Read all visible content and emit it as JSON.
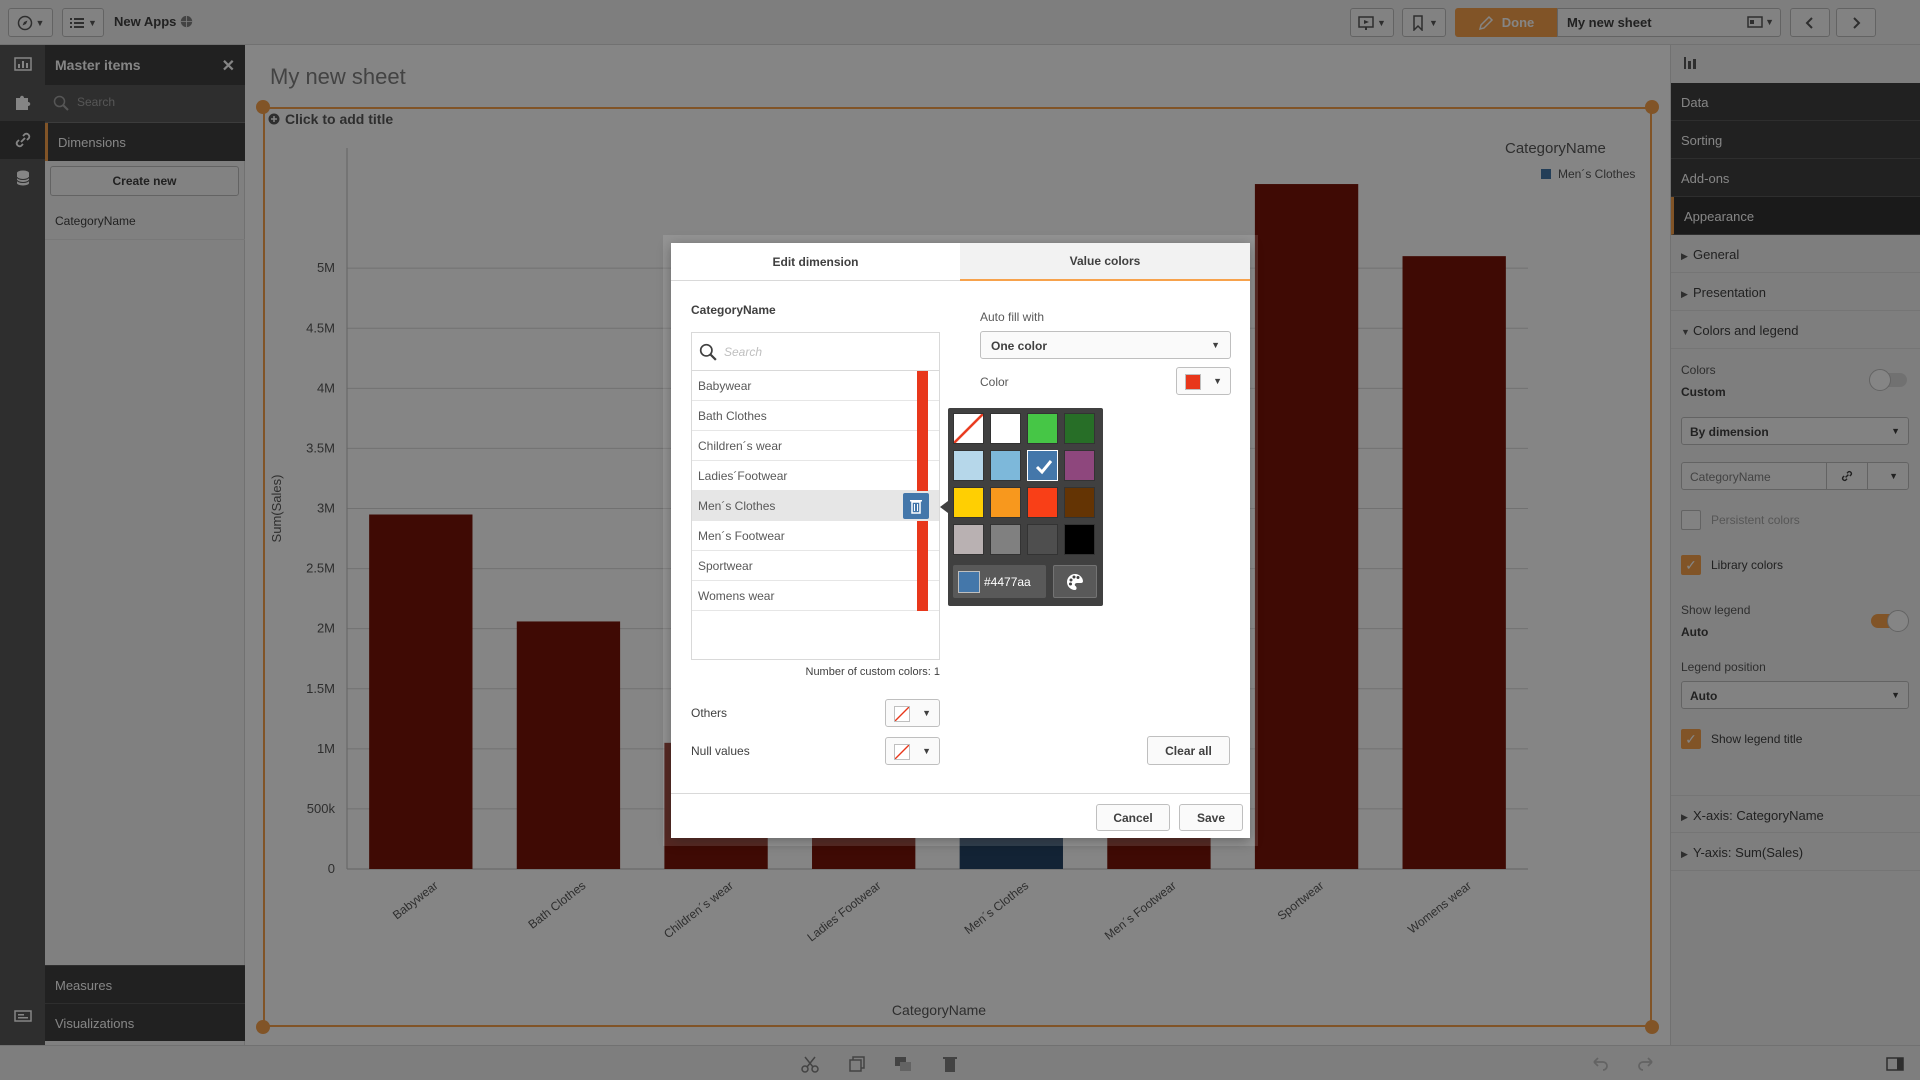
{
  "app": {
    "name": "New Apps"
  },
  "toolbar": {
    "done_label": "Done",
    "sheet_name": "My new sheet"
  },
  "left_panel": {
    "title": "Master items",
    "search_placeholder": "Search",
    "dimensions_label": "Dimensions",
    "create_new_label": "Create new",
    "items": [
      "CategoryName"
    ],
    "measures_label": "Measures",
    "visualizations_label": "Visualizations"
  },
  "sheet": {
    "title": "My new sheet",
    "chart_title_placeholder": "Click to add title"
  },
  "legend": {
    "title": "CategoryName",
    "item": "Men´s Clothes"
  },
  "chart_data": {
    "type": "bar",
    "categories": [
      "Babywear",
      "Bath Clothes",
      "Children´s wear",
      "Ladies´Footwear",
      "Men´s Clothes",
      "Men´s Footwear",
      "Sportwear",
      "Womens wear"
    ],
    "values": [
      2950000,
      2060000,
      1050000,
      800000,
      650000,
      780000,
      5700000,
      5100000
    ],
    "colors": [
      "#7a1408",
      "#7a1408",
      "#7a1408",
      "#7a1408",
      "#264466",
      "#7a1408",
      "#7a1408",
      "#7a1408"
    ],
    "ylabel": "Sum(Sales)",
    "xlabel": "CategoryName",
    "ylim": [
      0,
      6000000
    ],
    "yticks": [
      "0",
      "500k",
      "1M",
      "1.5M",
      "2M",
      "2.5M",
      "3M",
      "3.5M",
      "4M",
      "4.5M",
      "5M"
    ],
    "grid": true
  },
  "right_panel": {
    "tabs": [
      "Data",
      "Sorting",
      "Add-ons",
      "Appearance"
    ],
    "sections": [
      "General",
      "Presentation",
      "Colors and legend"
    ],
    "colors_label": "Colors",
    "colors_value": "Custom",
    "color_mode": "By dimension",
    "dimension_field": "CategoryName",
    "persistent_colors": "Persistent colors",
    "library_colors": "Library colors",
    "show_legend_label": "Show legend",
    "show_legend_value": "Auto",
    "legend_position_label": "Legend position",
    "legend_position_value": "Auto",
    "show_legend_title": "Show legend title",
    "x_axis": "X-axis: CategoryName",
    "y_axis": "Y-axis: Sum(Sales)"
  },
  "dialog": {
    "tab_edit": "Edit dimension",
    "tab_colors": "Value colors",
    "dimension_name": "CategoryName",
    "search_placeholder": "Search",
    "values": [
      "Babywear",
      "Bath Clothes",
      "Children´s wear",
      "Ladies´Footwear",
      "Men´s Clothes",
      "Men´s Footwear",
      "Sportwear",
      "Womens wear"
    ],
    "custom_count": "Number of custom colors: 1",
    "others_label": "Others",
    "null_label": "Null values",
    "autofill_label": "Auto fill with",
    "autofill_value": "One color",
    "color_label": "Color",
    "clear_all": "Clear all",
    "cancel": "Cancel",
    "save": "Save"
  },
  "palette": {
    "colors": [
      "none",
      "#ffffff",
      "#46c646",
      "#276e27",
      "#b6d7ea",
      "#7db8da",
      "#4477aa",
      "#8e477d",
      "#ffcf02",
      "#f8981d",
      "#f93f17",
      "#643404",
      "#b9b1b2",
      "#808080",
      "#4e4e4e",
      "#000000"
    ],
    "selected_index": 6,
    "hex": "#4477aa"
  },
  "colors": {
    "accent": "#f7a24c",
    "bar": "#e8371b",
    "selected": "#4477aa"
  }
}
